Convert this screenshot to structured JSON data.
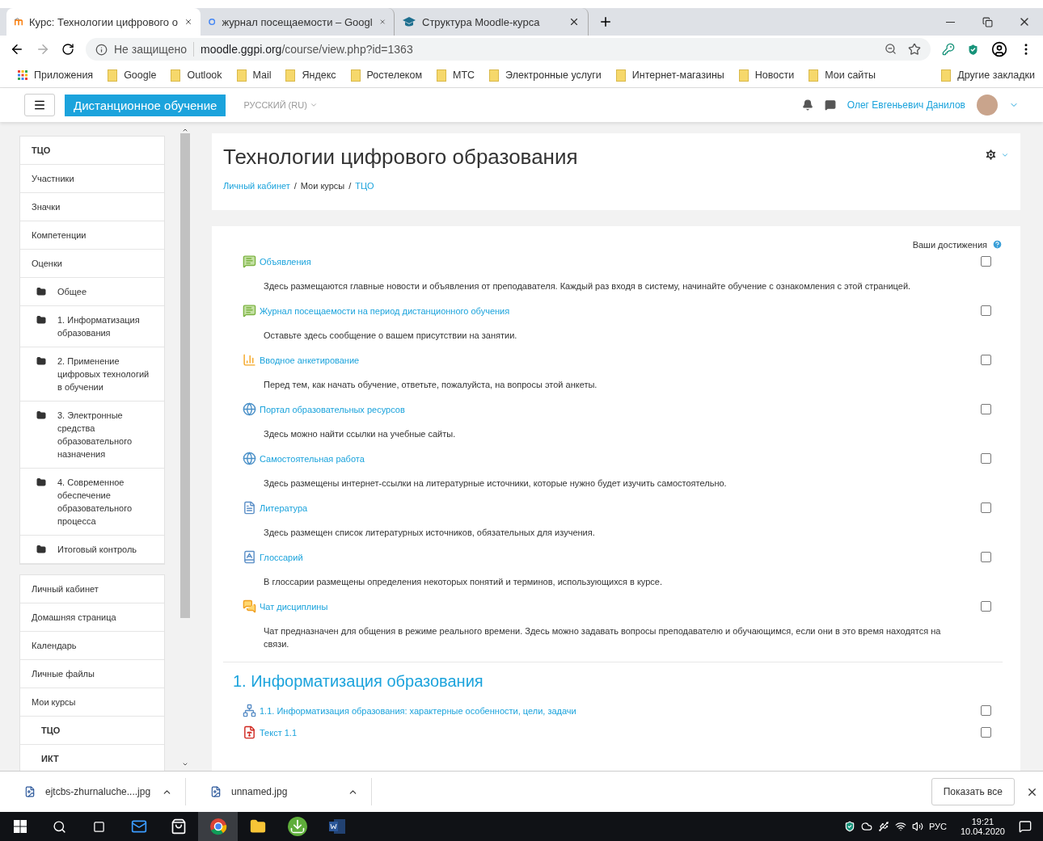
{
  "browser": {
    "tabs": [
      {
        "title": "Курс: Технологии цифрового о",
        "kind": "moodle",
        "selected": true
      },
      {
        "title": "журнал посещаемости – Googl",
        "kind": "google",
        "selected": false
      },
      {
        "title": "Структура Moodle-курса",
        "kind": "cap",
        "selected": false
      }
    ],
    "address": {
      "security": "Не защищено",
      "host": "moodle.ggpi.org",
      "path": "/course/view.php?id=1363"
    },
    "apps_label": "Приложения",
    "bookmarks": [
      "Google",
      "Outlook",
      "Mail",
      "Яндекс",
      "Ростелеком",
      "МТС",
      "Электронные услуги",
      "Интернет-магазины",
      "Новости",
      "Мои сайты"
    ],
    "other_bookmarks": "Другие закладки"
  },
  "navbar": {
    "site_name": "Дистанционное обучение",
    "language": "РУССКИЙ (RU)",
    "user_name": "Олег Евгеньевич Данилов"
  },
  "sidebar": {
    "course_block": [
      {
        "label": "ТЦО",
        "kind": "title"
      },
      {
        "label": "Участники",
        "kind": "link"
      },
      {
        "label": "Значки",
        "kind": "link"
      },
      {
        "label": "Компетенции",
        "kind": "link"
      },
      {
        "label": "Оценки",
        "kind": "link"
      },
      {
        "label": "Общее",
        "kind": "section"
      },
      {
        "label": "1. Информатизация образования",
        "kind": "section"
      },
      {
        "label": "2. Применение цифровых технологий в обучении",
        "kind": "section"
      },
      {
        "label": "3. Электронные средства образовательного назначения",
        "kind": "section"
      },
      {
        "label": "4. Современное обеспечение образовательного процесса",
        "kind": "section"
      },
      {
        "label": "Итоговый контроль",
        "kind": "section"
      }
    ],
    "site_block": [
      {
        "label": "Личный кабинет",
        "kind": "link"
      },
      {
        "label": "Домашняя страница",
        "kind": "link"
      },
      {
        "label": "Календарь",
        "kind": "link"
      },
      {
        "label": "Личные файлы",
        "kind": "link"
      },
      {
        "label": "Мои курсы",
        "kind": "link"
      },
      {
        "label": "ТЦО",
        "kind": "course"
      },
      {
        "label": "ИКТ",
        "kind": "course"
      }
    ]
  },
  "header": {
    "title": "Технологии цифрового образования",
    "separator": "/",
    "breadcrumbs": [
      {
        "label": "Личный кабинет",
        "link": true
      },
      {
        "label": "Мои курсы",
        "link": false
      },
      {
        "label": "ТЦО",
        "link": true
      }
    ]
  },
  "content": {
    "progress_label": "Ваши достижения",
    "activities": [
      {
        "kind": "forum",
        "name": "Объявления",
        "description": "Здесь размещаются главные новости и объявления от преподавателя. Каждый раз входя в систему, начинайте обучение с ознакомления с этой страницей.",
        "checked": false
      },
      {
        "kind": "forum",
        "name": "Журнал посещаемости на период дистанционного обучения",
        "description": "Оставьте здесь сообщение о вашем присутствии на занятии.",
        "checked": false
      },
      {
        "kind": "feedback",
        "name": "Вводное анкетирование",
        "description": "Перед тем, как начать обучение, ответьте, пожалуйста, на вопросы этой анкеты.",
        "checked": false
      },
      {
        "kind": "url",
        "name": "Портал образовательных ресурсов",
        "description": "Здесь можно найти ссылки на учебные сайты.",
        "checked": false
      },
      {
        "kind": "url",
        "name": "Самостоятельная работа",
        "description": "Здесь размещены интернет-ссылки на литературные источники, которые нужно будет изучить самостоятельно.",
        "checked": false
      },
      {
        "kind": "page",
        "name": "Литература",
        "description": "Здесь размещен список литературных источников, обязательных для изучения.",
        "checked": false
      },
      {
        "kind": "glossary",
        "name": "Глоссарий",
        "description": "В глоссарии размещены определения некоторых понятий и терминов, использующихся в курсе.",
        "checked": false
      },
      {
        "kind": "chat",
        "name": "Чат дисциплины",
        "description": "Чат предназначен для общения в режиме реального времени. Здесь можно задавать вопросы преподавателю и обучающимся, если они в это время находятся на связи.",
        "checked": false
      }
    ],
    "section": {
      "title": "1. Информатизация образования",
      "activities": [
        {
          "kind": "book",
          "name": "1.1. Информатизация образования: характерные особенности, цели, задачи",
          "checked": false
        },
        {
          "kind": "pdf",
          "name": "Текст 1.1",
          "checked": false
        }
      ]
    }
  },
  "downloads": {
    "files": [
      "ejtcbs-zhurnaluche....jpg",
      "unnamed.jpg"
    ],
    "show_all": "Показать все"
  },
  "taskbar": {
    "apps": [
      {
        "kind": "mail",
        "active": false
      },
      {
        "kind": "store",
        "active": false
      },
      {
        "kind": "chrome",
        "active": true
      },
      {
        "kind": "folder",
        "active": false
      },
      {
        "kind": "torrent",
        "active": false
      },
      {
        "kind": "word",
        "active": false
      }
    ],
    "language": "РУС",
    "time": "19:21",
    "date": "10.04.2020"
  }
}
